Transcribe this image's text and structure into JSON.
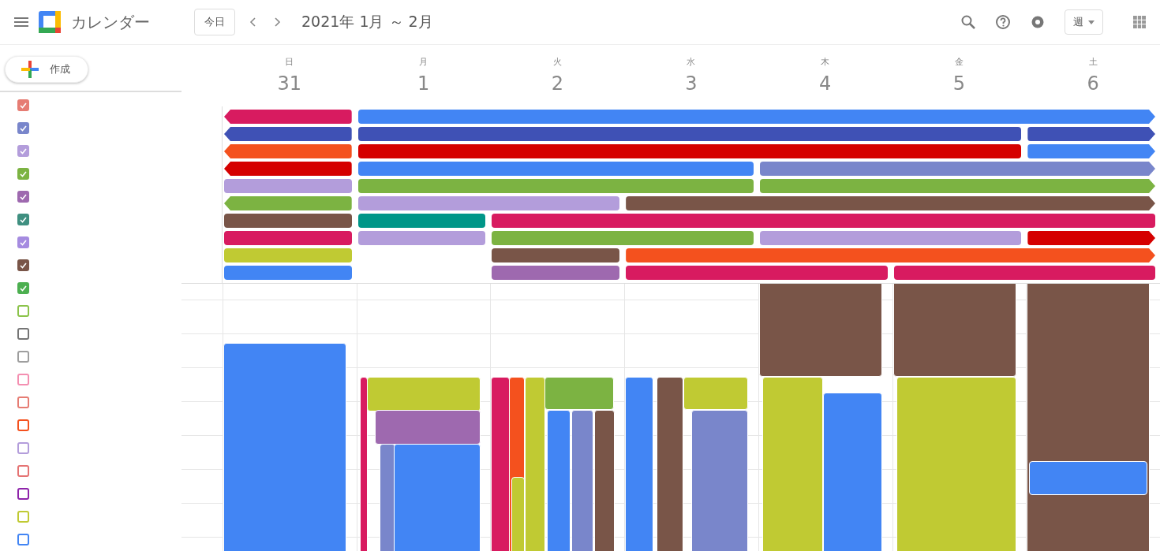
{
  "app": {
    "title": "カレンダー"
  },
  "toolbar": {
    "today": "今日",
    "range": "2021年 1月 ～ 2月",
    "view": "週"
  },
  "create": {
    "label": "作成"
  },
  "days": [
    {
      "weekday": "日",
      "date": "31"
    },
    {
      "weekday": "月",
      "date": "1"
    },
    {
      "weekday": "火",
      "date": "2"
    },
    {
      "weekday": "水",
      "date": "3"
    },
    {
      "weekday": "木",
      "date": "4"
    },
    {
      "weekday": "金",
      "date": "5"
    },
    {
      "weekday": "土",
      "date": "6"
    }
  ],
  "calendars": [
    {
      "color": "#e67c73",
      "checked": true
    },
    {
      "color": "#7986cb",
      "checked": true
    },
    {
      "color": "#b39ddb",
      "checked": true
    },
    {
      "color": "#7cb342",
      "checked": true
    },
    {
      "color": "#9e69af",
      "checked": true
    },
    {
      "color": "#3f8f80",
      "checked": true
    },
    {
      "color": "#a58be0",
      "checked": true
    },
    {
      "color": "#795548",
      "checked": true
    },
    {
      "color": "#4caf50",
      "checked": true
    },
    {
      "color": "#8bc34a",
      "checked": false
    },
    {
      "color": "#757575",
      "checked": false
    },
    {
      "color": "#9e9e9e",
      "checked": false
    },
    {
      "color": "#f48fb1",
      "checked": false
    },
    {
      "color": "#e67c73",
      "checked": false
    },
    {
      "color": "#f4511e",
      "checked": false
    },
    {
      "color": "#b39ddb",
      "checked": false
    },
    {
      "color": "#e57373",
      "checked": false
    },
    {
      "color": "#8e24aa",
      "checked": false
    },
    {
      "color": "#c0ca33",
      "checked": false
    },
    {
      "color": "#4285f4",
      "checked": false
    }
  ],
  "all_day_events": [
    {
      "color": "#d81b60"
    },
    {
      "color": "#4285f4"
    },
    {
      "color": "#3f51b5"
    },
    {
      "color": "#3f51b5"
    },
    {
      "color": "#3f51b5"
    },
    {
      "color": "#f4511e"
    },
    {
      "color": "#d50000"
    },
    {
      "color": "#4285f4"
    },
    {
      "color": "#d50000"
    },
    {
      "color": "#4285f4"
    },
    {
      "color": "#7986cb"
    },
    {
      "color": "#b39ddb"
    },
    {
      "color": "#7cb342"
    },
    {
      "color": "#7cb342"
    },
    {
      "color": "#7cb342"
    },
    {
      "color": "#b39ddb"
    },
    {
      "color": "#795548"
    },
    {
      "color": "#795548"
    },
    {
      "color": "#009688"
    },
    {
      "color": "#d81b60"
    },
    {
      "color": "#d81b60"
    },
    {
      "color": "#b39ddb"
    },
    {
      "color": "#7cb342"
    },
    {
      "color": "#b39ddb"
    },
    {
      "color": "#d50000"
    },
    {
      "color": "#c0ca33"
    },
    {
      "color": "#795548"
    },
    {
      "color": "#f4511e"
    },
    {
      "color": "#4285f4"
    },
    {
      "color": "#9e69af"
    },
    {
      "color": "#d81b60"
    },
    {
      "color": "#d81b60"
    }
  ],
  "events": [
    {
      "color": "#4285f4"
    },
    {
      "color": "#d81b60"
    },
    {
      "color": "#c0ca33"
    },
    {
      "color": "#9e69af"
    },
    {
      "color": "#7986cb"
    },
    {
      "color": "#4285f4"
    },
    {
      "color": "#d81b60"
    },
    {
      "color": "#f4511e"
    },
    {
      "color": "#c0ca33"
    },
    {
      "color": "#7cb342"
    },
    {
      "color": "#c0ca33"
    },
    {
      "color": "#4285f4"
    },
    {
      "color": "#7986cb"
    },
    {
      "color": "#795548"
    },
    {
      "color": "#4285f4"
    },
    {
      "color": "#795548"
    },
    {
      "color": "#c0ca33"
    },
    {
      "color": "#7986cb"
    },
    {
      "color": "#795548"
    },
    {
      "color": "#c0ca33"
    },
    {
      "color": "#4285f4"
    },
    {
      "color": "#795548"
    },
    {
      "color": "#c0ca33"
    },
    {
      "color": "#795548"
    },
    {
      "color": "#4285f4"
    }
  ]
}
